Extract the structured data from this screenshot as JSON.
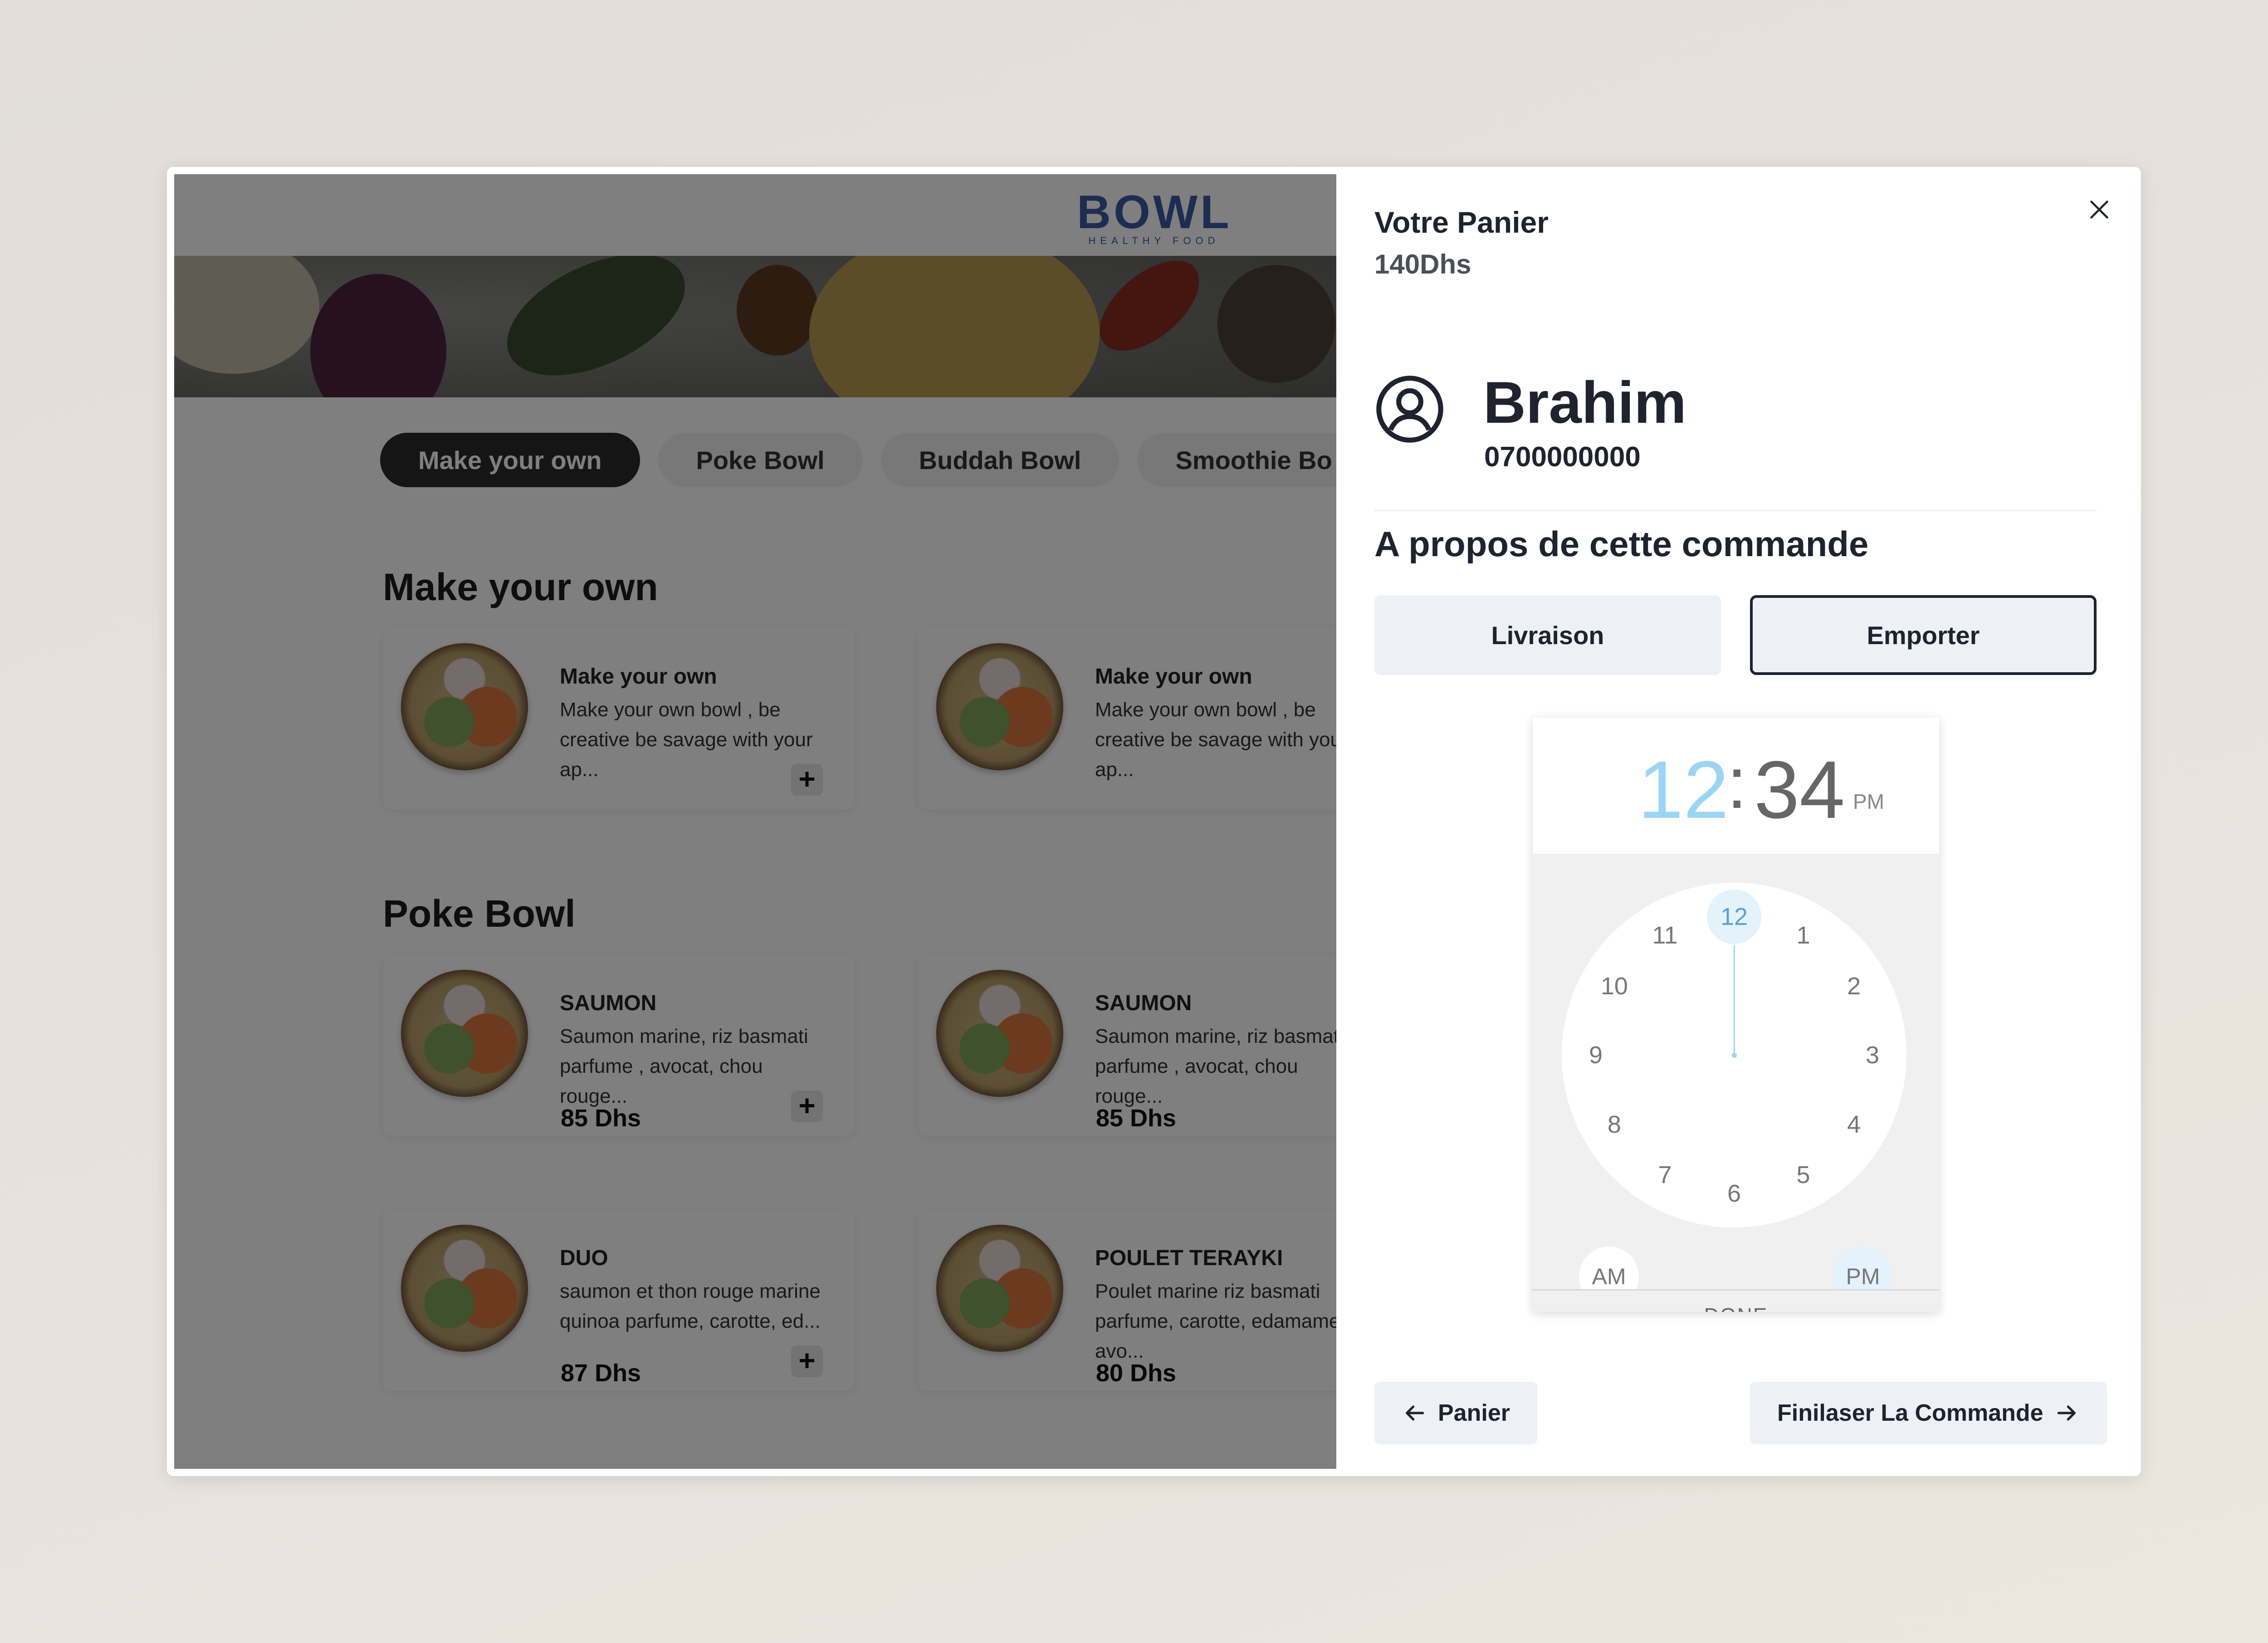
{
  "app": {
    "logo": "BOWL",
    "logo_tagline": "HEALTHY FOOD",
    "tabs": [
      "Make your own",
      "Poke Bowl",
      "Buddah Bowl",
      "Smoothie Bo"
    ],
    "sections": [
      {
        "title": "Make your own",
        "items": [
          {
            "name": "Make your own",
            "desc": "Make your own bowl , be creative be savage with your ap...",
            "price": ""
          },
          {
            "name": "Make your own",
            "desc": "Make your own bowl , be creative be savage with your ap...",
            "price": ""
          }
        ]
      },
      {
        "title": "Poke Bowl",
        "items": [
          {
            "name": "SAUMON",
            "desc": "Saumon marine, riz basmati parfume , avocat, chou rouge...",
            "price": "85 Dhs"
          },
          {
            "name": "SAUMON",
            "desc": "Saumon marine, riz basmati parfume , avocat, chou rouge...",
            "price": "85 Dhs"
          },
          {
            "name": "DUO",
            "desc": "saumon et thon rouge marine quinoa parfume, carotte, ed...",
            "price": "87 Dhs"
          },
          {
            "name": "POULET TERAYKI",
            "desc": "Poulet marine riz basmati parfume, carotte, edamame avo...",
            "price": "80 Dhs"
          }
        ]
      }
    ],
    "plus_label": "+"
  },
  "cart": {
    "title": "Votre Panier",
    "total": "140Dhs",
    "user_name": "Brahim",
    "user_phone": "0700000000",
    "about_title": "A propos de cette commande",
    "options": [
      {
        "label": "Livraison",
        "selected": false
      },
      {
        "label": "Emporter",
        "selected": true
      }
    ],
    "time_picker": {
      "hour": "12",
      "separator": ":",
      "minute": "34",
      "period": "PM",
      "dial_numbers": [
        "12",
        "1",
        "2",
        "3",
        "4",
        "5",
        "6",
        "7",
        "8",
        "9",
        "10",
        "11"
      ],
      "selected_hour": "12",
      "am_label": "AM",
      "pm_label": "PM",
      "done_label": "DONE"
    },
    "back_button": "Panier",
    "finish_button": "Finilaser La Commande"
  }
}
